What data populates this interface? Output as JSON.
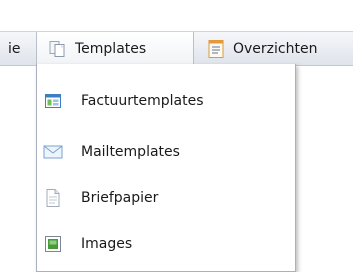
{
  "menubar": {
    "partial_label": "ie",
    "templates": {
      "label": "Templates",
      "icon": "copy-pages-icon"
    },
    "overzichten": {
      "label": "Overzichten",
      "icon": "report-document-icon"
    }
  },
  "dropdown": {
    "items": [
      {
        "label": "Factuurtemplates",
        "icon": "invoice-template-icon"
      },
      {
        "label": "Mailtemplates",
        "icon": "envelope-icon"
      },
      {
        "label": "Briefpapier",
        "icon": "letter-paper-icon"
      },
      {
        "label": "Images",
        "icon": "image-icon"
      }
    ]
  },
  "colors": {
    "menubar_bg": "#e9ecf2",
    "border": "#a9b1be",
    "icon_blue": "#3d7fc6",
    "icon_green": "#4a9a3c",
    "icon_orange": "#e7983a"
  }
}
